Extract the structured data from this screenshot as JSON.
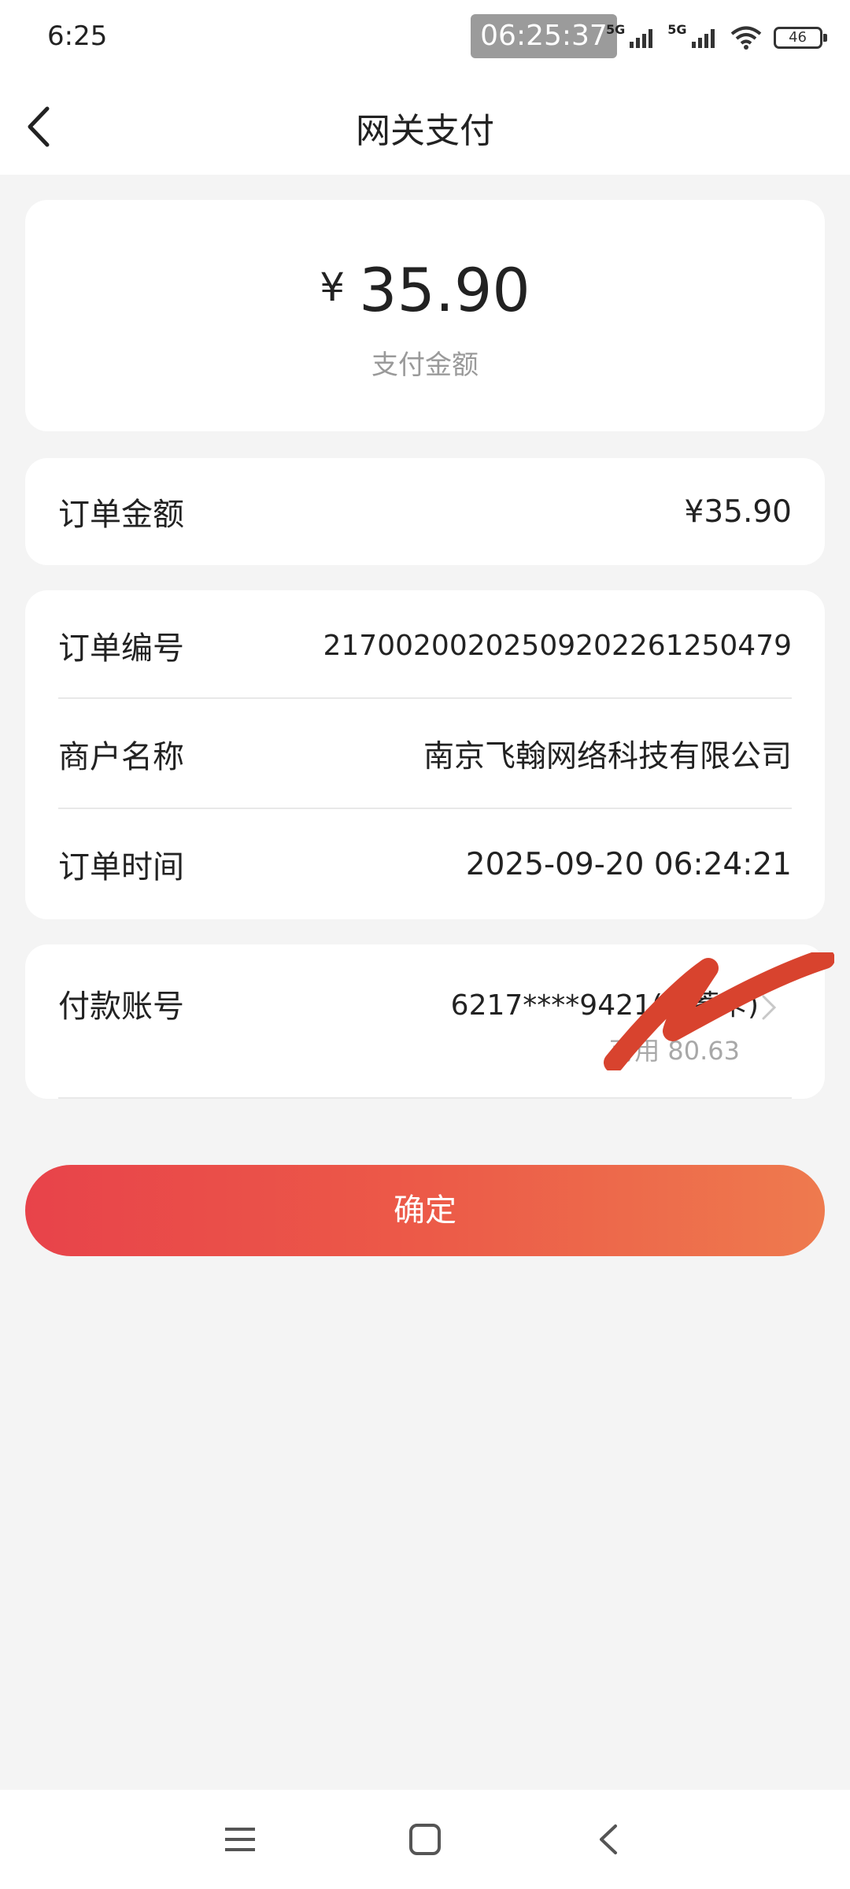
{
  "status_bar": {
    "time": "6:25",
    "clock_badge": "06:25:37",
    "network_1": "5G",
    "network_2": "5G",
    "battery": "46"
  },
  "nav": {
    "title": "网关支付"
  },
  "amount_card": {
    "currency_symbol": "¥",
    "amount": "35.90",
    "label": "支付金额"
  },
  "order_amount": {
    "label": "订单金额",
    "value": "¥35.90"
  },
  "details": {
    "order_number_label": "订单编号",
    "order_number_value": "217002002025092022612504​79",
    "merchant_label": "商户名称",
    "merchant_value": "南京飞翰网络科技有限公司",
    "order_time_label": "订单时间",
    "order_time_value": "2025-09-20 06:24:21"
  },
  "account": {
    "label": "付款账号",
    "number": "6217****9421(储蓄卡)",
    "balance": "可用 80.63"
  },
  "confirm_button": "确定",
  "colors": {
    "accent_start": "#e8434a",
    "accent_end": "#ee7a4e",
    "background": "#f4f4f4",
    "scribble": "#d8432e"
  }
}
